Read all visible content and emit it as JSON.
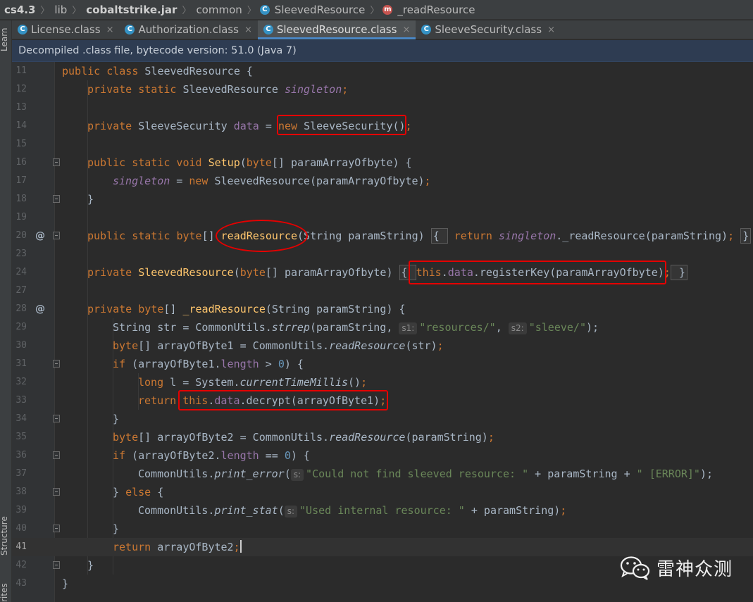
{
  "breadcrumb": {
    "project": "cs4.3",
    "lib": "lib",
    "jar": "cobaltstrike.jar",
    "package": "common",
    "class": "SleevedResource",
    "method": "_readResource"
  },
  "side_tools": {
    "learn": "Learn",
    "structure": "Structure",
    "favorites": "rites"
  },
  "tabs": [
    {
      "label": "License.class",
      "close": "×"
    },
    {
      "label": "Authorization.class",
      "close": "×"
    },
    {
      "label": "SleevedResource.class",
      "close": "×"
    },
    {
      "label": "SleeveSecurity.class",
      "close": "×"
    }
  ],
  "banner": "Decompiled .class file, bytecode version: 51.0 (Java 7)",
  "line_numbers": [
    "11",
    "12",
    "13",
    "14",
    "15",
    "16",
    "17",
    "18",
    "19",
    "20",
    "23",
    "24",
    "27",
    "28",
    "29",
    "30",
    "31",
    "32",
    "33",
    "34",
    "35",
    "36",
    "37",
    "38",
    "39",
    "40",
    "41",
    "42",
    "43"
  ],
  "gutter_marks": {
    "line20": "@",
    "line28": "@"
  },
  "code": {
    "l11": {
      "kw": "public class ",
      "name": "SleevedResource {"
    },
    "l12": {
      "kw": "private static ",
      "type": "SleevedResource ",
      "field": "singleton",
      "end": ";"
    },
    "l14": {
      "kw": "private ",
      "type": "SleeveSecurity ",
      "field": "data",
      "eq": " = ",
      "kw2": "new ",
      "call": "SleeveSecurity()",
      "end": ";"
    },
    "l16": {
      "kw": "public static void ",
      "fn": "Setup",
      "args_kw": "byte",
      "args": "[] paramArrayOfbyte) {"
    },
    "l17": {
      "field": "singleton",
      "eq": " = ",
      "kw": "new ",
      "rest": "SleevedResource(paramArrayOfbyte)",
      "end": ";"
    },
    "l18": "}",
    "l20": {
      "kw": "public static ",
      "kw2": "byte",
      "br": "[] ",
      "fn": "readResource",
      "args": "(String paramString) ",
      "open": "{ ",
      "kw3": "return ",
      "field": "singleton",
      "rest": "._readResource(paramString)",
      "end": "; ",
      "close": "}"
    },
    "l24": {
      "kw": "private ",
      "fn": "SleevedResource",
      "args_kw": "byte",
      "args": "[] paramArrayOfbyte) ",
      "open": "{ ",
      "kw2": "this",
      "dot": ".",
      "field": "data",
      "rest": ".registerKey(paramArrayOfbyte)",
      "end": ";",
      "close": " }"
    },
    "l28": {
      "kw": "private ",
      "kw2": "byte",
      "br": "[] ",
      "fn": "_readResource",
      "args": "(String paramString) {"
    },
    "l29": {
      "type": "String str = CommonUtils.",
      "call": "strrep",
      "open": "(paramString, ",
      "h1": "s1:",
      "s1": "\"resources/\"",
      "comma": ", ",
      "h2": "s2:",
      "s2": "\"sleeve/\"",
      "end": ");"
    },
    "l30": {
      "kw": "byte",
      "rest": "[] arrayOfByte1 = CommonUtils.",
      "call": "readResource",
      "args": "(str)",
      "end": ";"
    },
    "l31": {
      "kw": "if ",
      "a": "(arrayOfByte1.",
      "field": "length",
      "b": " > ",
      "num": "0",
      "c": ") {"
    },
    "l32": {
      "kw": "long ",
      "a": "l = System.",
      "call": "currentTimeMillis",
      "b": "()",
      "end": ";"
    },
    "l33": {
      "kw": "return ",
      "kw2": "this",
      "dot": ".",
      "field": "data",
      "rest": ".decrypt(arrayOfByte1)",
      "end": ";"
    },
    "l34": "}",
    "l35": {
      "kw": "byte",
      "rest": "[] arrayOfByte2 = CommonUtils.",
      "call": "readResource",
      "args": "(paramString)",
      "end": ";"
    },
    "l36": {
      "kw": "if ",
      "a": "(arrayOfByte2.",
      "field": "length",
      "b": " == ",
      "num": "0",
      "c": ") {"
    },
    "l37": {
      "a": "CommonUtils.",
      "call": "print_error",
      "open": "(",
      "h": "s:",
      "s1": "\"Could not find sleeved resource: \"",
      "b": " + paramString + ",
      "s2": "\" [ERROR]\"",
      "end": ");"
    },
    "l38": {
      "a": "} ",
      "kw": "else",
      "b": " {"
    },
    "l39": {
      "a": "CommonUtils.",
      "call": "print_stat",
      "open": "(",
      "h": "s:",
      "s1": "\"Used internal resource: \"",
      "b": " + paramString)",
      "end": ";"
    },
    "l40": "}",
    "l41": {
      "kw": "return ",
      "rest": "arrayOfByte2",
      "end": ";"
    },
    "l42": "}",
    "l43": "}"
  },
  "watermark": {
    "label": "雷神众测",
    "icon": "wechat-icon"
  },
  "colors": {
    "keyword": "#cc7832",
    "method_decl": "#ffc66d",
    "field": "#9876aa",
    "string": "#6a8759",
    "number": "#6897bb",
    "annotation_red": "#e50000",
    "banner_bg": "#2e3c52"
  }
}
